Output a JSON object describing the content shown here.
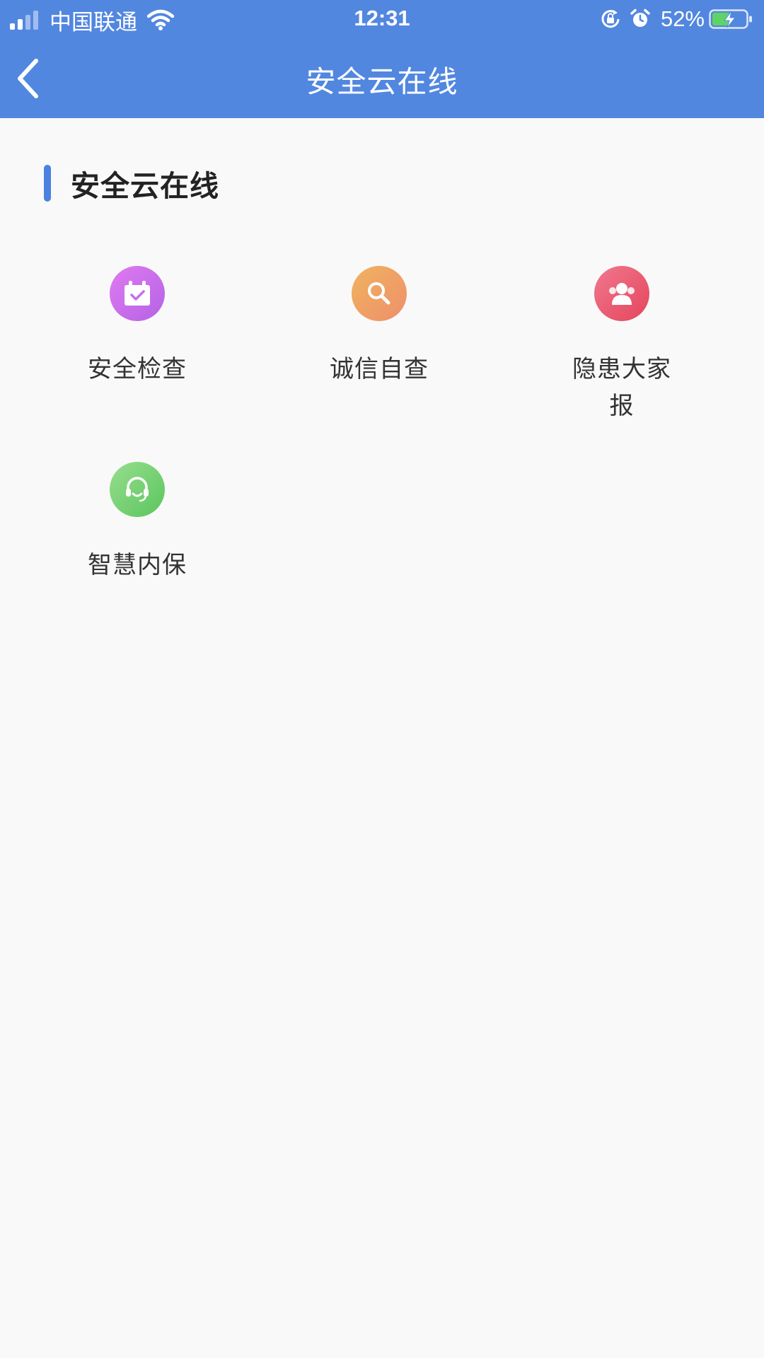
{
  "status_bar": {
    "carrier": "中国联通",
    "time": "12:31",
    "battery": "52%"
  },
  "nav": {
    "title": "安全云在线"
  },
  "section": {
    "title": "安全云在线"
  },
  "grid": {
    "items": [
      {
        "label": "安全检查",
        "icon": "calendar-check-icon",
        "color": "#c46fec"
      },
      {
        "label": "诚信自查",
        "icon": "magnifier-icon",
        "color": "#f0a164"
      },
      {
        "label": "隐患大家报",
        "icon": "people-icon",
        "color": "#ea5d74"
      },
      {
        "label": "智慧内保",
        "icon": "headset-icon",
        "color": "#76d175"
      }
    ]
  },
  "colors": {
    "header": "#5287e0",
    "accent_bar": "#4b81e0",
    "background": "#f9f9f9"
  }
}
